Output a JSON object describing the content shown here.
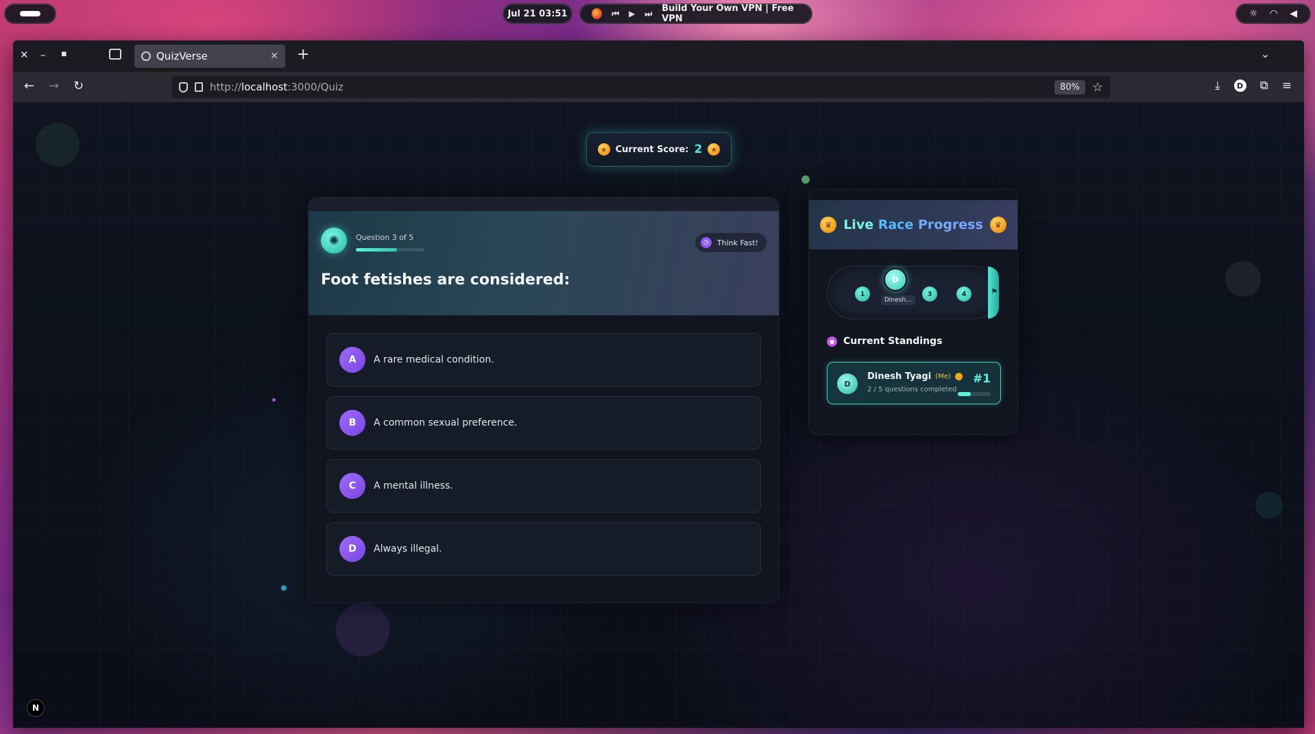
{
  "os": {
    "clock": "Jul 21  03:51",
    "media_title": "Build Your Own VPN | Free VPN",
    "media_controls": {
      "prev": "⏮",
      "play": "▶",
      "next": "⏭"
    },
    "tray_icons": [
      "brightness-icon",
      "wifi-icon",
      "volume-icon"
    ]
  },
  "browser": {
    "tab_title": "QuizVerse",
    "url_prefix": "http://",
    "url_host": "localhost",
    "url_path": ":3000/Quiz",
    "zoom": "80%"
  },
  "score": {
    "label": "Current Score:",
    "value": "2"
  },
  "quiz": {
    "question_counter": "Question 3 of 5",
    "progress_fraction": 0.6,
    "think_badge": "Think Fast!",
    "question": "Foot fetishes are considered:",
    "options": [
      {
        "letter": "A",
        "text": "A rare medical condition."
      },
      {
        "letter": "B",
        "text": "A common sexual preference."
      },
      {
        "letter": "C",
        "text": "A mental illness."
      },
      {
        "letter": "D",
        "text": "Always illegal."
      }
    ]
  },
  "race": {
    "title_parts": [
      "Live",
      "Race",
      "Progress"
    ],
    "milestones": [
      "1",
      "3",
      "4"
    ],
    "racer_initial": "D",
    "racer_tag": "Dinesh...",
    "standings_title": "Current Standings",
    "standings": [
      {
        "initial": "D",
        "name": "Dinesh Tyagi",
        "me_label": "(Me)",
        "progress_text": "2 / 5 questions completed",
        "progress_fraction": 0.4,
        "rank": "#1"
      }
    ]
  },
  "devtools_badge": "N",
  "colors": {
    "accent_teal": "#4ee7d6",
    "accent_purple": "#8f5bf0",
    "gold": "#f29a1a"
  }
}
